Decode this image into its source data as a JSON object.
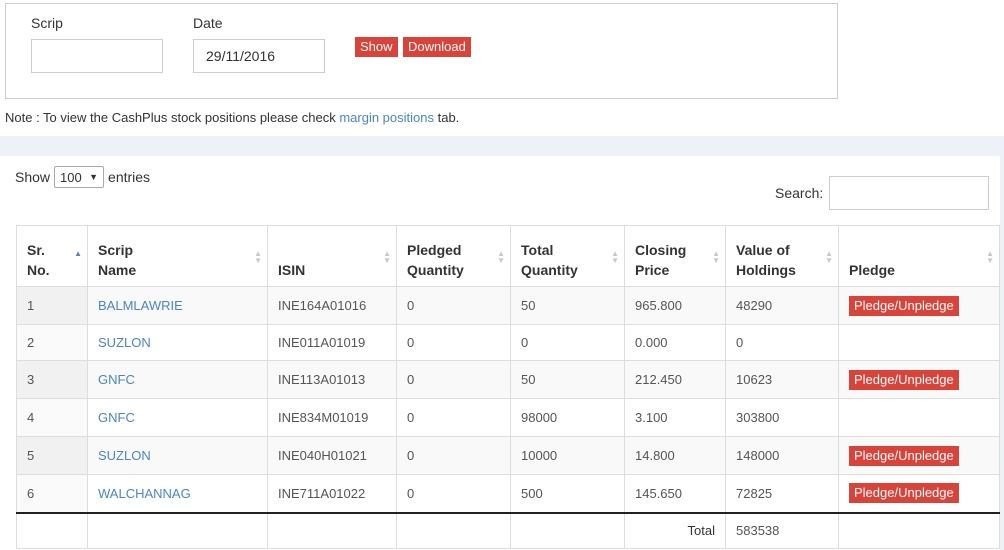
{
  "form": {
    "scrip_label": "Scrip",
    "scrip_value": "",
    "date_label": "Date",
    "date_value": "29/11/2016",
    "show_button": "Show",
    "download_button": "Download"
  },
  "note": {
    "prefix": "Note : To view the CashPlus stock positions please check ",
    "link": "margin positions",
    "suffix": " tab."
  },
  "table_controls": {
    "show_label": "Show",
    "entries_value": "100",
    "entries_label": "entries",
    "search_label": "Search:"
  },
  "columns": [
    "Sr. No.",
    "Scrip Name",
    "ISIN",
    "Pledged Quantity",
    "Total Quantity",
    "Closing Price",
    "Value of Holdings",
    "Pledge"
  ],
  "rows": [
    {
      "sr": "1",
      "scrip": "BALMLAWRIE",
      "isin": "INE164A01016",
      "pledged": "0",
      "total": "50",
      "price": "965.800",
      "value": "48290",
      "pledge": "Pledge/Unpledge"
    },
    {
      "sr": "2",
      "scrip": "SUZLON",
      "isin": "INE011A01019",
      "pledged": "0",
      "total": "0",
      "price": "0.000",
      "value": "0",
      "pledge": ""
    },
    {
      "sr": "3",
      "scrip": "GNFC",
      "isin": "INE113A01013",
      "pledged": "0",
      "total": "50",
      "price": "212.450",
      "value": "10623",
      "pledge": "Pledge/Unpledge"
    },
    {
      "sr": "4",
      "scrip": "GNFC",
      "isin": "INE834M01019",
      "pledged": "0",
      "total": "98000",
      "price": "3.100",
      "value": "303800",
      "pledge": ""
    },
    {
      "sr": "5",
      "scrip": "SUZLON",
      "isin": "INE040H01021",
      "pledged": "0",
      "total": "10000",
      "price": "14.800",
      "value": "148000",
      "pledge": "Pledge/Unpledge"
    },
    {
      "sr": "6",
      "scrip": "WALCHANNAG",
      "isin": "INE711A01022",
      "pledged": "0",
      "total": "500",
      "price": "145.650",
      "value": "72825",
      "pledge": "Pledge/Unpledge"
    }
  ],
  "totals": {
    "label": "Total",
    "value": "583538"
  }
}
